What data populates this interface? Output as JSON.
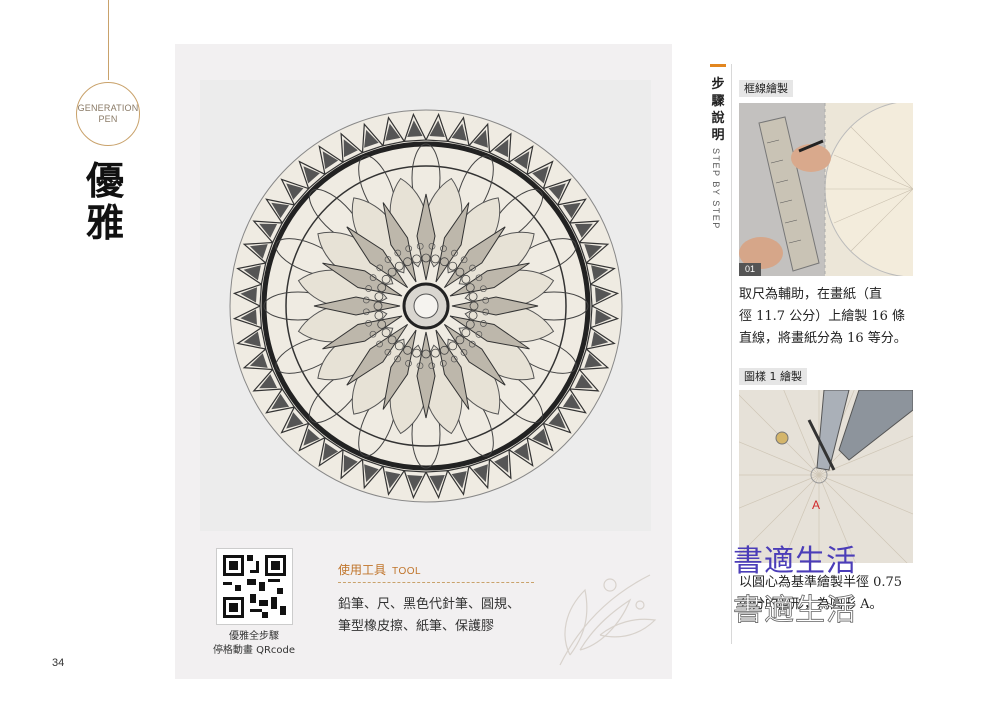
{
  "badge": {
    "line1": "GENERATION",
    "line2": "PEN"
  },
  "title": {
    "char1": "優",
    "char2": "雅"
  },
  "page_number": "34",
  "qr": {
    "caption_line1": "優雅全步驟",
    "caption_line2": "停格動畫 QRcode"
  },
  "tools": {
    "heading": "使用工具",
    "heading_en": "TOOL",
    "line1": "鉛筆、尺、黑色代針筆、圓規、",
    "line2": "筆型橡皮擦、紙筆、保護膠"
  },
  "steps": {
    "heading_chars": [
      "步",
      "驟",
      "說",
      "明"
    ],
    "heading_en": "STEP BY STEP",
    "step1": {
      "label": "框線繪製",
      "number": "01",
      "desc_lines": [
        "取尺為輔助，在畫紙（直",
        "徑 11.7 公分）上繪製 16 條",
        "直線，將畫紙分為 16 等分。"
      ]
    },
    "step2": {
      "label": "圖樣 1 繪製",
      "point_label": "A",
      "desc_lines": [
        "以圓心為基準繪製半徑 0.75",
        "公分的圓形，為圓形 A。"
      ]
    }
  },
  "watermark": {
    "text": "書適生活"
  },
  "colors": {
    "accent": "#c9a26b",
    "orange": "#e2861f",
    "tool_heading": "#c0742a",
    "panel": "#f2f0f1"
  }
}
